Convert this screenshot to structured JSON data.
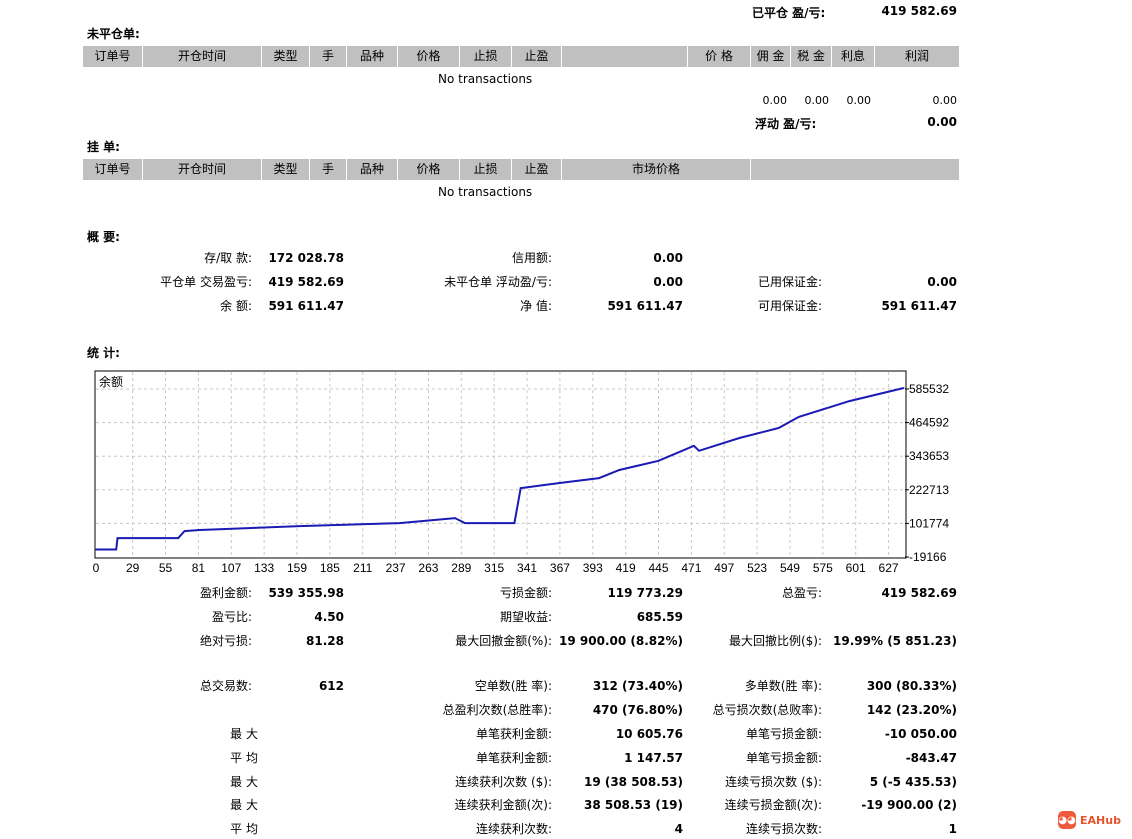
{
  "closed_pl": {
    "label": "已平仓 盈/亏:",
    "value": "419 582.69"
  },
  "open_trades": {
    "title": "未平仓单:",
    "headers": [
      "订单号",
      "开仓时间",
      "类型",
      "手",
      "品种",
      "价格",
      "止损",
      "止盈",
      "",
      "价 格",
      "佣 金",
      "税 金",
      "利息",
      "利润"
    ],
    "empty": "No transactions",
    "totals": [
      "0.00",
      "0.00",
      "0.00",
      "0.00"
    ],
    "floating_label": "浮动 盈/亏:",
    "floating_value": "0.00"
  },
  "pending": {
    "title": "挂 单:",
    "headers": [
      "订单号",
      "开仓时间",
      "类型",
      "手",
      "品种",
      "价格",
      "止损",
      "止盈",
      "市场价格",
      ""
    ],
    "empty": "No transactions"
  },
  "summary": {
    "title": "概 要:",
    "rows": [
      [
        "存/取 款:",
        "172 028.78",
        "信用额:",
        "0.00",
        "",
        ""
      ],
      [
        "平仓单 交易盈亏:",
        "419 582.69",
        "未平仓单 浮动盈/亏:",
        "0.00",
        "已用保证金:",
        "0.00"
      ],
      [
        "余 额:",
        "591 611.47",
        "净 值:",
        "591 611.47",
        "可用保证金:",
        "591 611.47"
      ]
    ]
  },
  "stats": {
    "title": "统 计:",
    "rows": [
      [
        "盈利金额:",
        "539 355.98",
        "亏损金额:",
        "119 773.29",
        "总盈亏:",
        "419 582.69"
      ],
      [
        "盈亏比:",
        "4.50",
        "期望收益:",
        "685.59",
        "",
        ""
      ],
      [
        "绝对亏损:",
        "81.28",
        "最大回撤金额(%):",
        "19 900.00 (8.82%)",
        "最大回撤比例($):",
        "19.99% (5 851.23)"
      ],
      [
        "总交易数:",
        "612",
        "空单数(胜 率):",
        "312 (73.40%)",
        "多单数(胜 率):",
        "300 (80.33%)"
      ],
      [
        "",
        "",
        "总盈利次数(总胜率):",
        "470 (76.80%)",
        "总亏损次数(总败率):",
        "142 (23.20%)"
      ],
      [
        "最 大",
        "",
        "单笔获利金额:",
        "10 605.76",
        "单笔亏损金额:",
        "-10 050.00"
      ],
      [
        "平 均",
        "",
        "单笔获利金额:",
        "1 147.57",
        "单笔亏损金额:",
        "-843.47"
      ],
      [
        "最 大",
        "",
        "连续获利次数 ($):",
        "19 (38 508.53)",
        "连续亏损次数 ($):",
        "5 (-5 435.53)"
      ],
      [
        "最 大",
        "",
        "连续获利金额(次):",
        "38 508.53 (19)",
        "连续亏损金额(次):",
        "-19 900.00 (2)"
      ],
      [
        "平 均",
        "",
        "连续获利次数:",
        "4",
        "连续亏损次数:",
        "1"
      ]
    ]
  },
  "chart_data": {
    "type": "line",
    "title": "余额",
    "x_ticks": [
      0,
      29,
      55,
      81,
      107,
      133,
      159,
      185,
      211,
      237,
      263,
      289,
      315,
      341,
      367,
      393,
      419,
      445,
      471,
      497,
      523,
      549,
      575,
      601,
      627
    ],
    "y_ticks": [
      -19166,
      101774,
      222713,
      343653,
      464592,
      585532
    ],
    "xlim": [
      0,
      640
    ],
    "ylim": [
      -19166,
      600000
    ],
    "grid": true,
    "line_color": "#1a1ab4",
    "series": [
      {
        "x": [
          0,
          16,
          17,
          65,
          70,
          82,
          161,
          240,
          284,
          292,
          331,
          336,
          366,
          398,
          414,
          445,
          473,
          477,
          509,
          540,
          556,
          596,
          639
        ],
        "y": [
          8000,
          8000,
          49000,
          49000,
          74000,
          78000,
          92000,
          103000,
          121000,
          103000,
          103000,
          229000,
          247000,
          265000,
          294000,
          327000,
          381000,
          363000,
          409000,
          445000,
          485000,
          542000,
          589000
        ]
      }
    ]
  },
  "watermark": "EAHub"
}
